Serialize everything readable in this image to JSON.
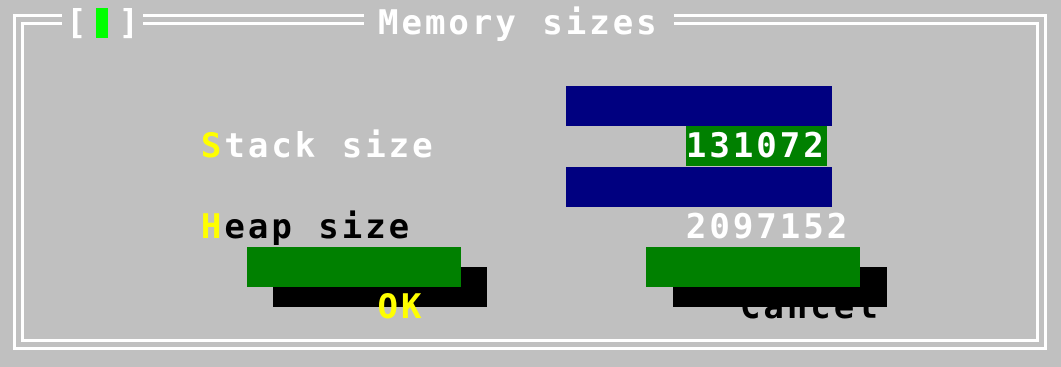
{
  "window": {
    "title": "Memory sizes",
    "close_open": "[",
    "close_close": "]"
  },
  "fields": {
    "stack": {
      "label_hot": "S",
      "label_rest": "tack size",
      "value": "131072"
    },
    "heap": {
      "label_hot": "H",
      "label_rest": "eap size",
      "value": "2097152"
    }
  },
  "buttons": {
    "ok_hot": "OK",
    "cancel": "Cancel"
  },
  "colors": {
    "background": "#c0c0c0",
    "field_bg": "#000080",
    "selection_bg": "#008000",
    "button_bg": "#008000",
    "hotkey": "#ffff00",
    "close_mark": "#00ff00"
  }
}
